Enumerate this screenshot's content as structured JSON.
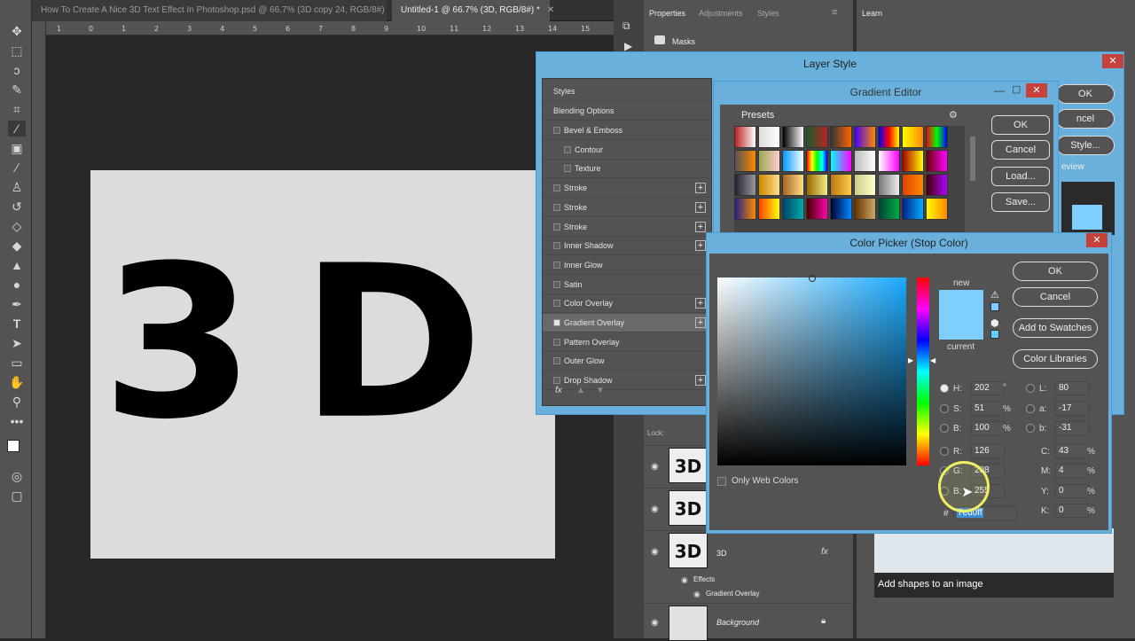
{
  "tabs": [
    {
      "label": "How To Create A Nice 3D Text Effect In Photoshop.psd @ 66.7% (3D copy 24, RGB/8#)"
    },
    {
      "label": "Untitled-1 @ 66.7% (3D, RGB/8#) *"
    }
  ],
  "ruler": {
    "ticks": [
      "1",
      "0",
      "1",
      "2",
      "3",
      "4",
      "5",
      "6",
      "7",
      "8",
      "9",
      "10",
      "11",
      "12",
      "13",
      "14",
      "15"
    ]
  },
  "canvas": {
    "text": "3D"
  },
  "panels": {
    "properties_tab": "Properties",
    "adjustments_tab": "Adjustments",
    "styles_tab": "Styles",
    "masks_label": "Masks",
    "learn_tab": "Learn",
    "learn_caption": "Add shapes to an image",
    "lock_label": "Lock:"
  },
  "layers": [
    {
      "thumb": "3D",
      "name": ""
    },
    {
      "thumb": "3D",
      "name": ""
    },
    {
      "thumb": "3D",
      "name": "3D"
    },
    {
      "thumb": "",
      "name": "Background"
    }
  ],
  "layer_effects": {
    "effects": "Effects",
    "gradient_overlay": "Gradient Overlay"
  },
  "layer_style": {
    "title": "Layer Style",
    "styles_header": "Styles",
    "blending": "Blending Options",
    "items": [
      {
        "label": "Bevel & Emboss",
        "checked": false,
        "plus": false
      },
      {
        "label": "Contour",
        "checked": false,
        "plus": false
      },
      {
        "label": "Texture",
        "checked": false,
        "plus": false
      },
      {
        "label": "Stroke",
        "checked": false,
        "plus": true
      },
      {
        "label": "Stroke",
        "checked": false,
        "plus": true
      },
      {
        "label": "Stroke",
        "checked": false,
        "plus": true
      },
      {
        "label": "Inner Shadow",
        "checked": false,
        "plus": true
      },
      {
        "label": "Inner Glow",
        "checked": false,
        "plus": false
      },
      {
        "label": "Satin",
        "checked": false,
        "plus": false
      },
      {
        "label": "Color Overlay",
        "checked": false,
        "plus": true
      },
      {
        "label": "Gradient Overlay",
        "checked": true,
        "plus": true
      },
      {
        "label": "Pattern Overlay",
        "checked": false,
        "plus": false
      },
      {
        "label": "Outer Glow",
        "checked": false,
        "plus": false
      },
      {
        "label": "Drop Shadow",
        "checked": false,
        "plus": true
      }
    ],
    "fx": "fx",
    "ok": "OK",
    "cancel": "ncel",
    "new_style": "Style...",
    "preview": "eview"
  },
  "gradient_editor": {
    "title": "Gradient Editor",
    "presets": "Presets",
    "ok": "OK",
    "cancel": "Cancel",
    "load": "Load...",
    "save": "Save..."
  },
  "color_picker": {
    "title": "Color Picker (Stop Color)",
    "new_label": "new",
    "current_label": "current",
    "ok": "OK",
    "cancel": "Cancel",
    "add_swatches": "Add to Swatches",
    "color_libraries": "Color Libraries",
    "only_web": "Only Web Colors",
    "new_color": "#7ecfff",
    "current_color": "#7ecfff",
    "fields": {
      "H": {
        "label": "H:",
        "value": "202",
        "unit": "°"
      },
      "S": {
        "label": "S:",
        "value": "51",
        "unit": "%"
      },
      "B": {
        "label": "B:",
        "value": "100",
        "unit": "%"
      },
      "R": {
        "label": "R:",
        "value": "126"
      },
      "G": {
        "label": "G:",
        "value": "208"
      },
      "Bl": {
        "label": "B:",
        "value": "255"
      },
      "L": {
        "label": "L:",
        "value": "80"
      },
      "a": {
        "label": "a:",
        "value": "-17"
      },
      "b": {
        "label": "b:",
        "value": "-31"
      },
      "C": {
        "label": "C:",
        "value": "43",
        "unit": "%"
      },
      "M": {
        "label": "M:",
        "value": "4",
        "unit": "%"
      },
      "Y": {
        "label": "Y:",
        "value": "0",
        "unit": "%"
      },
      "K": {
        "label": "K:",
        "value": "0",
        "unit": "%"
      }
    },
    "hex_label": "#",
    "hex": "7ed0ff"
  }
}
